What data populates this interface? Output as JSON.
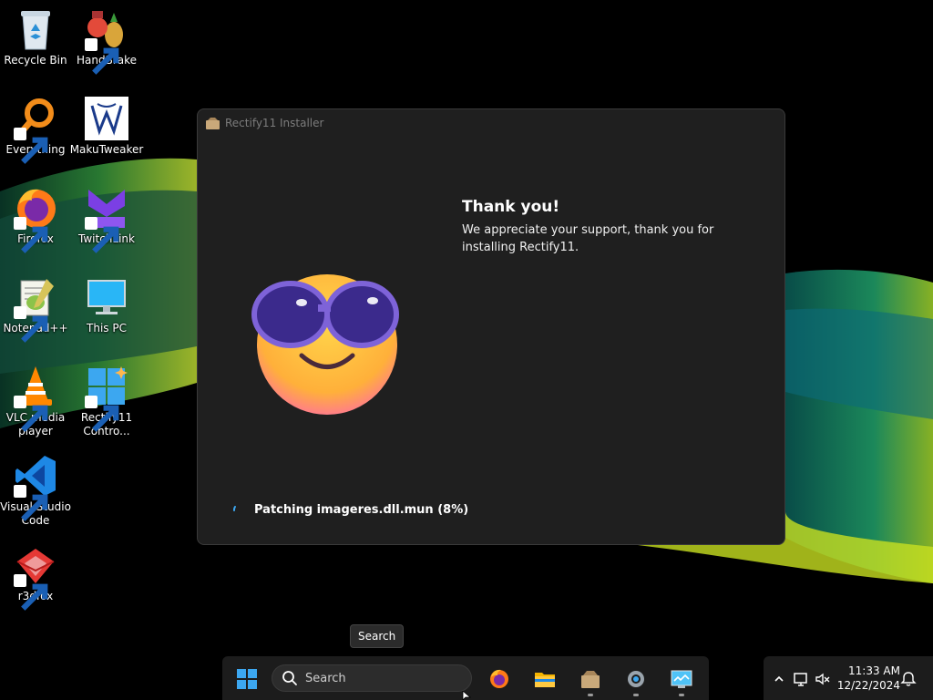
{
  "desktop": {
    "icons": [
      {
        "label": "Recycle Bin",
        "icon": "recycle-bin-icon"
      },
      {
        "label": "HandBrake",
        "icon": "handbrake-icon"
      },
      {
        "label": "Everything",
        "icon": "everything-icon"
      },
      {
        "label": "MakuTweaker",
        "icon": "makutweaker-icon"
      },
      {
        "label": "Firefox",
        "icon": "firefox-icon"
      },
      {
        "label": "TwitchLink",
        "icon": "twitchlink-icon"
      },
      {
        "label": "Notepad++",
        "icon": "notepadpp-icon"
      },
      {
        "label": "This PC",
        "icon": "this-pc-icon"
      },
      {
        "label": "VLC media\nplayer",
        "icon": "vlc-icon"
      },
      {
        "label": "Rectify11\nContro...",
        "icon": "rectify11-control-icon"
      },
      {
        "label": "Visual Studio\nCode",
        "icon": "vscode-icon"
      },
      {
        "label": "r3dfox",
        "icon": "r3dfox-icon"
      }
    ]
  },
  "installer": {
    "title": "Rectify11 Installer",
    "heading": "Thank you!",
    "message": "We appreciate your support, thank you for installing Rectify11.",
    "status": "Patching imageres.dll.mun (8%)",
    "emoji": "sunglasses-smiley-icon"
  },
  "tooltip": {
    "text": "Search"
  },
  "taskbar": {
    "search_placeholder": "Search",
    "pinned": [
      "start-icon",
      "firefox-icon",
      "file-explorer-icon",
      "rectify11-installer-icon",
      "settings-icon",
      "control-panel-icon"
    ]
  },
  "tray": {
    "time": "11:33 AM",
    "date": "12/22/2024",
    "icons": [
      "chevron-up-icon",
      "network-icon",
      "volume-muted-icon",
      "notification-bell-icon"
    ]
  },
  "colors": {
    "window_bg": "#1f1f1f",
    "taskbar_bg": "#1c1c1c",
    "accent_blue": "#0078d4"
  }
}
